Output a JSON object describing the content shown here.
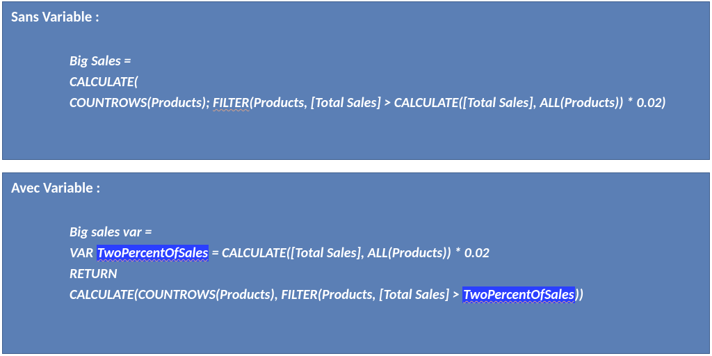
{
  "panels": {
    "sans": {
      "heading": "Sans Variable :",
      "code_line1": "Big Sales =",
      "code_line2": "CALCULATE(",
      "code_line3_a": "COUNTROWS(Products); ",
      "code_line3_filter": "FILTER",
      "code_line3_b": "(Products, [Total Sales] > CALCULATE([Total Sales], ALL(Products)) * 0.02)"
    },
    "avec": {
      "heading": "Avec Variable :",
      "code_line1": "Big sales var =",
      "code_line2_a": "VAR ",
      "code_line2_var": "TwoPercentOfSales",
      "code_line2_b": " = CALCULATE([Total Sales], ALL(Products)) * 0.02",
      "code_line3": "RETURN",
      "code_line4_a": "CALCULATE(COUNTROWS(Products), FILTER(Products, [Total Sales] > ",
      "code_line4_var": "TwoPercentOfSales",
      "code_line4_b": "))"
    }
  }
}
